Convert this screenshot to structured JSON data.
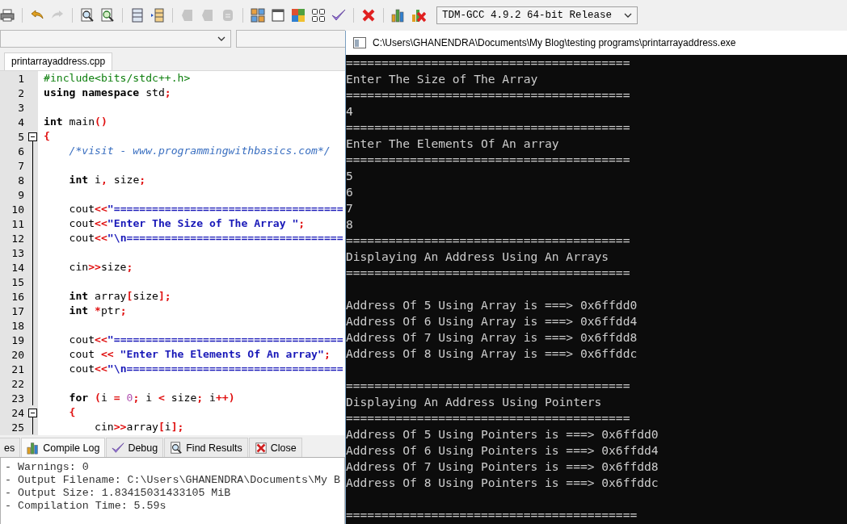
{
  "toolbar_groups": [
    {
      "items": [
        {
          "kind": "printer",
          "disabled": false
        }
      ]
    },
    {
      "items": [
        {
          "kind": "undo",
          "disabled": false
        },
        {
          "kind": "redo",
          "disabled": true
        }
      ]
    },
    {
      "items": [
        {
          "kind": "find",
          "disabled": false
        },
        {
          "kind": "replace",
          "disabled": false
        }
      ]
    },
    {
      "items": [
        {
          "kind": "panel",
          "disabled": false
        },
        {
          "kind": "indent",
          "disabled": false
        }
      ]
    },
    {
      "items": [
        {
          "kind": "bookmark",
          "disabled": true
        },
        {
          "kind": "bookmark",
          "disabled": true
        },
        {
          "kind": "comment",
          "disabled": true
        }
      ]
    },
    {
      "items": [
        {
          "kind": "grid",
          "disabled": false
        },
        {
          "kind": "window",
          "disabled": false
        },
        {
          "kind": "quad",
          "disabled": false
        },
        {
          "kind": "tiles",
          "disabled": false
        },
        {
          "kind": "check",
          "disabled": false
        }
      ]
    },
    {
      "items": [
        {
          "kind": "cross",
          "disabled": false
        }
      ]
    },
    {
      "items": [
        {
          "kind": "chart",
          "disabled": false
        },
        {
          "kind": "chartx",
          "disabled": false
        }
      ]
    }
  ],
  "compiler_select": {
    "value": "TDM-GCC 4.9.2 64-bit Release"
  },
  "editor": {
    "tab": {
      "label": "printarrayaddress.cpp",
      "selected": true
    },
    "lines": [
      {
        "number": "1",
        "kind": "plain",
        "tokens": [
          {
            "kind": "pre",
            "text": "#include<bits/stdc++.h>"
          }
        ]
      },
      {
        "number": "2",
        "kind": "plain",
        "tokens": [
          {
            "kind": "kw",
            "text": "using"
          },
          {
            "kind": "kw",
            "text": " namespace"
          },
          {
            "kind": "plain",
            "text": " std"
          },
          {
            "kind": "op",
            "text": ";"
          }
        ]
      },
      {
        "number": "3",
        "kind": "plain"
      },
      {
        "number": "4",
        "kind": "plain",
        "tokens": [
          {
            "kind": "kw",
            "text": "int"
          },
          {
            "kind": "plain",
            "text": " main"
          },
          {
            "kind": "op",
            "text": "()"
          }
        ]
      },
      {
        "number": "5",
        "kind": "fold",
        "tokens": [
          {
            "kind": "op",
            "text": "{"
          }
        ]
      },
      {
        "number": "6",
        "kind": "body",
        "tokens": [
          {
            "kind": "cmt",
            "text": "    /*visit - www.programmingwithbasics.com*/"
          }
        ]
      },
      {
        "number": "7",
        "kind": "body"
      },
      {
        "number": "8",
        "kind": "body",
        "tokens": [
          {
            "kind": "kw",
            "text": "    int"
          },
          {
            "kind": "plain",
            "text": " i"
          },
          {
            "kind": "op",
            "text": ","
          },
          {
            "kind": "plain",
            "text": " size"
          },
          {
            "kind": "op",
            "text": ";"
          }
        ]
      },
      {
        "number": "9",
        "kind": "body"
      },
      {
        "number": "10",
        "kind": "body",
        "tokens": [
          {
            "kind": "plain",
            "text": "    cout"
          },
          {
            "kind": "op",
            "text": "<<"
          },
          {
            "kind": "str",
            "text": "\"===================================="
          }
        ]
      },
      {
        "number": "11",
        "kind": "body",
        "tokens": [
          {
            "kind": "plain",
            "text": "    cout"
          },
          {
            "kind": "op",
            "text": "<<"
          },
          {
            "kind": "str",
            "text": "\"Enter The Size of The Array \""
          },
          {
            "kind": "op",
            "text": ";"
          }
        ]
      },
      {
        "number": "12",
        "kind": "body",
        "tokens": [
          {
            "kind": "plain",
            "text": "    cout"
          },
          {
            "kind": "op",
            "text": "<<"
          },
          {
            "kind": "str",
            "text": "\"\\n=================================="
          }
        ]
      },
      {
        "number": "13",
        "kind": "body"
      },
      {
        "number": "14",
        "kind": "body",
        "tokens": [
          {
            "kind": "plain",
            "text": "    cin"
          },
          {
            "kind": "op",
            "text": ">>"
          },
          {
            "kind": "plain",
            "text": "size"
          },
          {
            "kind": "op",
            "text": ";"
          }
        ]
      },
      {
        "number": "15",
        "kind": "body"
      },
      {
        "number": "16",
        "kind": "body",
        "tokens": [
          {
            "kind": "kw",
            "text": "    int"
          },
          {
            "kind": "plain",
            "text": " array"
          },
          {
            "kind": "op",
            "text": "["
          },
          {
            "kind": "plain",
            "text": "size"
          },
          {
            "kind": "op",
            "text": "];"
          }
        ]
      },
      {
        "number": "17",
        "kind": "body",
        "tokens": [
          {
            "kind": "kw",
            "text": "    int"
          },
          {
            "kind": "op",
            "text": " *"
          },
          {
            "kind": "plain",
            "text": "ptr"
          },
          {
            "kind": "op",
            "text": ";"
          }
        ]
      },
      {
        "number": "18",
        "kind": "body"
      },
      {
        "number": "19",
        "kind": "body",
        "tokens": [
          {
            "kind": "plain",
            "text": "    cout"
          },
          {
            "kind": "op",
            "text": "<<"
          },
          {
            "kind": "str",
            "text": "\"===================================="
          }
        ]
      },
      {
        "number": "20",
        "kind": "body",
        "tokens": [
          {
            "kind": "plain",
            "text": "    cout "
          },
          {
            "kind": "op",
            "text": "<<"
          },
          {
            "kind": "str",
            "text": " \"Enter The Elements Of An array\""
          },
          {
            "kind": "op",
            "text": ";"
          }
        ]
      },
      {
        "number": "21",
        "kind": "body",
        "tokens": [
          {
            "kind": "plain",
            "text": "    cout"
          },
          {
            "kind": "op",
            "text": "<<"
          },
          {
            "kind": "str",
            "text": "\"\\n=================================="
          }
        ]
      },
      {
        "number": "22",
        "kind": "body"
      },
      {
        "number": "23",
        "kind": "body",
        "tokens": [
          {
            "kind": "kw",
            "text": "    for"
          },
          {
            "kind": "op",
            "text": " ("
          },
          {
            "kind": "plain",
            "text": "i "
          },
          {
            "kind": "op",
            "text": "="
          },
          {
            "kind": "num",
            "text": " 0"
          },
          {
            "kind": "op",
            "text": ";"
          },
          {
            "kind": "plain",
            "text": " i "
          },
          {
            "kind": "op",
            "text": "<"
          },
          {
            "kind": "plain",
            "text": " size"
          },
          {
            "kind": "op",
            "text": ";"
          },
          {
            "kind": "plain",
            "text": " i"
          },
          {
            "kind": "op",
            "text": "++)"
          }
        ]
      },
      {
        "number": "24",
        "kind": "fold",
        "tokens": [
          {
            "kind": "op",
            "text": "    {"
          }
        ]
      },
      {
        "number": "25",
        "kind": "body",
        "tokens": [
          {
            "kind": "plain",
            "text": "        cin"
          },
          {
            "kind": "op",
            "text": ">>"
          },
          {
            "kind": "plain",
            "text": "array"
          },
          {
            "kind": "op",
            "text": "["
          },
          {
            "kind": "plain",
            "text": "i"
          },
          {
            "kind": "op",
            "text": "];"
          }
        ]
      }
    ]
  },
  "bottom_tabs": [
    {
      "label": "es",
      "kind": "plain",
      "selected": false
    },
    {
      "label": "Compile Log",
      "kind": "chart",
      "selected": true
    },
    {
      "label": "Debug",
      "kind": "check",
      "selected": false
    },
    {
      "label": "Find Results",
      "kind": "find",
      "selected": false
    },
    {
      "label": "Close",
      "kind": "close",
      "selected": false
    }
  ],
  "compile_log": [
    "- Warnings: 0",
    "- Output Filename: C:\\Users\\GHANENDRA\\Documents\\My B",
    "- Output Size: 1.83415031433105 MiB",
    "- Compilation Time: 5.59s"
  ],
  "console": {
    "title": "C:\\Users\\GHANENDRA\\Documents\\My Blog\\testing programs\\printarrayaddress.exe",
    "lines": [
      {
        "kind": "text",
        "text": "========================================"
      },
      {
        "kind": "text",
        "text": "Enter The Size of The Array"
      },
      {
        "kind": "text",
        "text": "========================================"
      },
      {
        "kind": "text",
        "text": "4"
      },
      {
        "kind": "text",
        "text": "========================================"
      },
      {
        "kind": "text",
        "text": "Enter The Elements Of An array"
      },
      {
        "kind": "text",
        "text": "========================================"
      },
      {
        "kind": "text",
        "text": "5"
      },
      {
        "kind": "text",
        "text": "6"
      },
      {
        "kind": "text",
        "text": "7"
      },
      {
        "kind": "text",
        "text": "8"
      },
      {
        "kind": "text",
        "text": "========================================"
      },
      {
        "kind": "text",
        "text": "Displaying An Address Using An Arrays"
      },
      {
        "kind": "text",
        "text": "========================================"
      },
      {
        "kind": "blank"
      },
      {
        "kind": "text",
        "text": "Address Of 5 Using Array is ===> 0x6ffdd0"
      },
      {
        "kind": "text",
        "text": "Address Of 6 Using Array is ===> 0x6ffdd4"
      },
      {
        "kind": "text",
        "text": "Address Of 7 Using Array is ===> 0x6ffdd8"
      },
      {
        "kind": "text",
        "text": "Address Of 8 Using Array is ===> 0x6ffddc"
      },
      {
        "kind": "blank"
      },
      {
        "kind": "text",
        "text": "========================================"
      },
      {
        "kind": "text",
        "text": "Displaying An Address Using Pointers"
      },
      {
        "kind": "text",
        "text": "========================================"
      },
      {
        "kind": "text",
        "text": "Address Of 5 Using Pointers is ===> 0x6ffdd0"
      },
      {
        "kind": "text",
        "text": "Address Of 6 Using Pointers is ===> 0x6ffdd4"
      },
      {
        "kind": "text",
        "text": "Address Of 7 Using Pointers is ===> 0x6ffdd8"
      },
      {
        "kind": "text",
        "text": "Address Of 8 Using Pointers is ===> 0x6ffddc"
      },
      {
        "kind": "blank"
      },
      {
        "kind": "text",
        "text": "========================================="
      }
    ]
  }
}
